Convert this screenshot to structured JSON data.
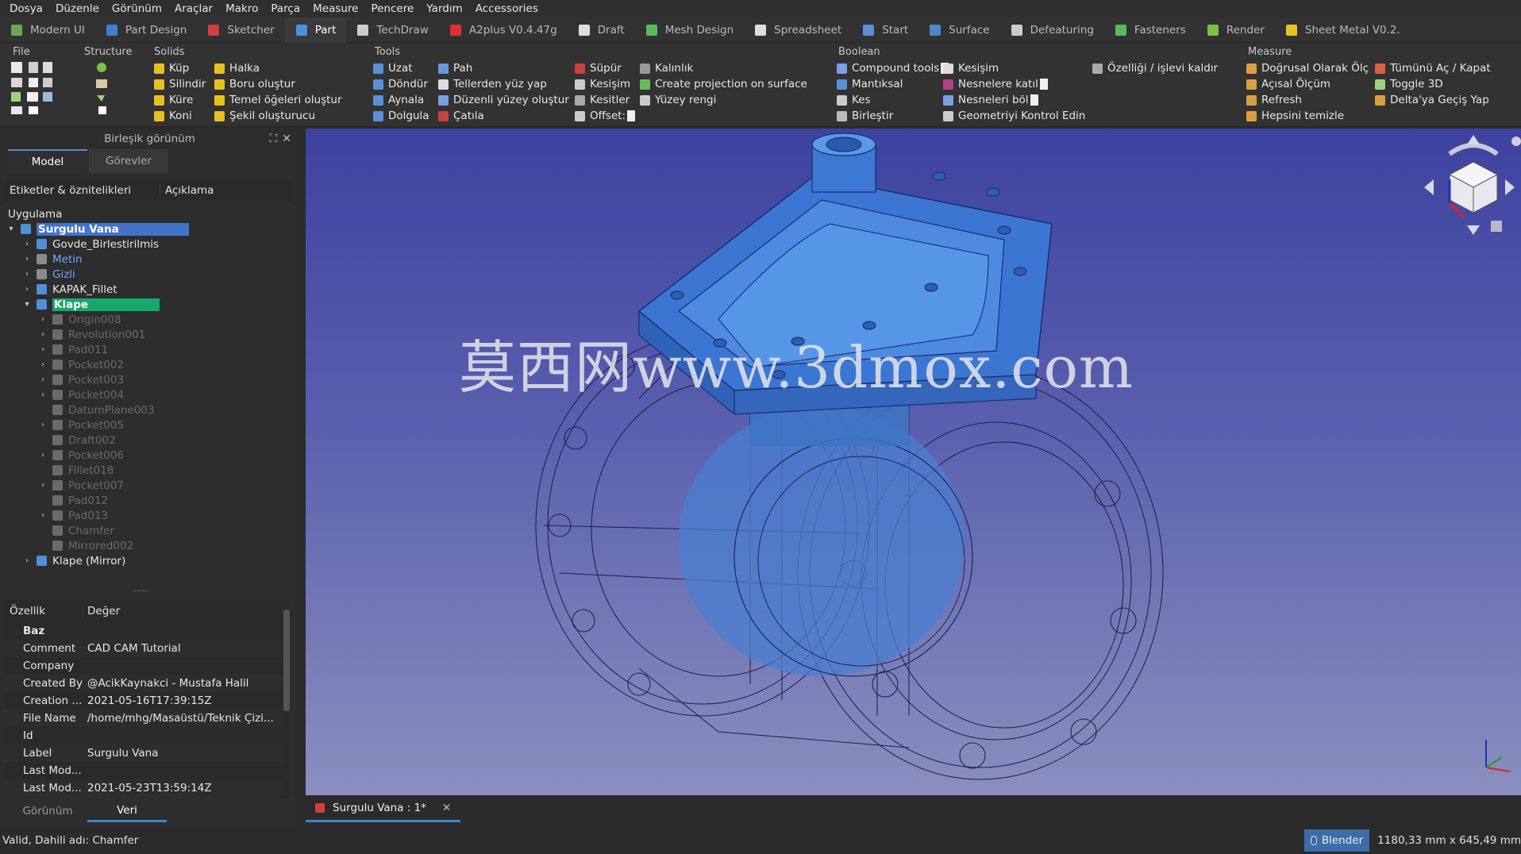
{
  "menu": [
    "Dosya",
    "Düzenle",
    "Görünüm",
    "Araçlar",
    "Makro",
    "Parça",
    "Measure",
    "Pencere",
    "Yardım",
    "Accessories"
  ],
  "workbenches": [
    {
      "label": "Modern UI",
      "color": "#6aa84f"
    },
    {
      "label": "Part Design",
      "color": "#3d7fd0"
    },
    {
      "label": "Sketcher",
      "color": "#d04040"
    },
    {
      "label": "Part",
      "color": "#4a90e2"
    },
    {
      "label": "TechDraw",
      "color": "#cccccc"
    },
    {
      "label": "A2plus V0.4.47g",
      "color": "#e03030"
    },
    {
      "label": "Draft",
      "color": "#dddddd"
    },
    {
      "label": "Mesh Design",
      "color": "#5cb85c"
    },
    {
      "label": "Spreadsheet",
      "color": "#dddddd"
    },
    {
      "label": "Start",
      "color": "#5b8fd6"
    },
    {
      "label": "Surface",
      "color": "#4f86c6"
    },
    {
      "label": "Defeaturing",
      "color": "#cccccc"
    },
    {
      "label": "Fasteners",
      "color": "#5cb85c"
    },
    {
      "label": "Render",
      "color": "#7bc142"
    },
    {
      "label": "Sheet Metal V0.2.",
      "color": "#e6c229"
    }
  ],
  "toolbar_groups": {
    "file": "File",
    "structure": "Structure",
    "solids": "Solids",
    "tools": "Tools",
    "boolean": "Boolean",
    "measure": "Measure"
  },
  "solids": [
    "Küp",
    "Silindir",
    "Küre",
    "Koni",
    "Halka",
    "Boru oluştur",
    "Temel öğeleri oluştur",
    "Şekil oluşturucu"
  ],
  "tools": [
    "Uzat",
    "Döndür",
    "Aynala",
    "Dolgula",
    "Pah",
    "Tellerden yüz yap",
    "Düzenli yüzey oluştur",
    "Çatıla",
    "Süpür",
    "Kesişim",
    "Kesitler",
    "Offset:",
    "Kalınlık",
    "Create projection on surface",
    "Yüzey rengi"
  ],
  "boolean": [
    "Compound tools",
    "Mantıksal",
    "Kes",
    "Birleştir",
    "Kesişim",
    "Nesnelere katıl",
    "Nesneleri böl",
    "Geometriyi Kontrol Edin",
    "Özelliği / işlevi kaldır"
  ],
  "measure": [
    "Doğrusal Olarak Ölç",
    "Açısal Ölçüm",
    "Refresh",
    "Hepsini temizle",
    "Tümünü Aç / Kapat",
    "Toggle 3D",
    "Delta'ya Geçiş Yap"
  ],
  "panel": {
    "title": "Birleşik görünüm",
    "tab_model": "Model",
    "tab_tasks": "Görevler",
    "col_labels": "Etiketler & öznitelikleri",
    "col_desc": "Açıklama",
    "app_label": "Uygulama"
  },
  "tree": [
    {
      "label": "Surgulu Vana",
      "level": 0,
      "arrow": "open",
      "state": "selected-blue",
      "bold": true
    },
    {
      "label": "Govde_Birlestirilmis",
      "level": 1,
      "arrow": "closed",
      "state": "normal"
    },
    {
      "label": "Metin",
      "level": 1,
      "arrow": "closed",
      "state": "link"
    },
    {
      "label": "Gizli",
      "level": 1,
      "arrow": "closed",
      "state": "link"
    },
    {
      "label": "KAPAK_Fillet",
      "level": 1,
      "arrow": "closed",
      "state": "normal"
    },
    {
      "label": "Klape",
      "level": 1,
      "arrow": "open",
      "state": "selected-green",
      "bold": true
    },
    {
      "label": "Origin008",
      "level": 2,
      "arrow": "closed",
      "state": "dim"
    },
    {
      "label": "Revolution001",
      "level": 2,
      "arrow": "closed",
      "state": "dim"
    },
    {
      "label": "Pad011",
      "level": 2,
      "arrow": "closed",
      "state": "dim"
    },
    {
      "label": "Pocket002",
      "level": 2,
      "arrow": "closed",
      "state": "dim"
    },
    {
      "label": "Pocket003",
      "level": 2,
      "arrow": "closed",
      "state": "dim"
    },
    {
      "label": "Pocket004",
      "level": 2,
      "arrow": "closed",
      "state": "dim"
    },
    {
      "label": "DatumPlane003",
      "level": 2,
      "arrow": "none",
      "state": "dim"
    },
    {
      "label": "Pocket005",
      "level": 2,
      "arrow": "closed",
      "state": "dim"
    },
    {
      "label": "Draft002",
      "level": 2,
      "arrow": "none",
      "state": "dim"
    },
    {
      "label": "Pocket006",
      "level": 2,
      "arrow": "closed",
      "state": "dim"
    },
    {
      "label": "Fillet018",
      "level": 2,
      "arrow": "none",
      "state": "dim"
    },
    {
      "label": "Pocket007",
      "level": 2,
      "arrow": "closed",
      "state": "dim"
    },
    {
      "label": "Pad012",
      "level": 2,
      "arrow": "none",
      "state": "dim"
    },
    {
      "label": "Pad013",
      "level": 2,
      "arrow": "closed",
      "state": "dim"
    },
    {
      "label": "Chamfer",
      "level": 2,
      "arrow": "none",
      "state": "dim"
    },
    {
      "label": "Mirrored002",
      "level": 2,
      "arrow": "none",
      "state": "dim"
    },
    {
      "label": "Klape (Mirror)",
      "level": 1,
      "arrow": "closed",
      "state": "normal"
    }
  ],
  "props": {
    "col_prop": "Özellik",
    "col_value": "Değer",
    "group": "Baz",
    "rows": [
      {
        "k": "Comment",
        "v": "CAD CAM Tutorial"
      },
      {
        "k": "Company",
        "v": ""
      },
      {
        "k": "Created By",
        "v": "@AcikKaynakci - Mustafa Halil"
      },
      {
        "k": "Creation ...",
        "v": "2021-05-16T17:39:15Z"
      },
      {
        "k": "File Name",
        "v": "/home/mhg/Masaüstü/Teknik Çizi..."
      },
      {
        "k": "Id",
        "v": ""
      },
      {
        "k": "Label",
        "v": "Surgulu Vana"
      },
      {
        "k": "Last Mod...",
        "v": ""
      },
      {
        "k": "Last Mod...",
        "v": "2021-05-23T13:59:14Z"
      }
    ]
  },
  "bottom_tabs": {
    "view": "Görünüm",
    "data": "Veri"
  },
  "doc_tab": "Surgulu Vana : 1*",
  "watermark": "莫西网www.3dmox.com",
  "status": {
    "message": "Valid, Dahili adı: Chamfer",
    "nav": "Blender",
    "dims": "1180,33 mm x 645,49 mm"
  }
}
